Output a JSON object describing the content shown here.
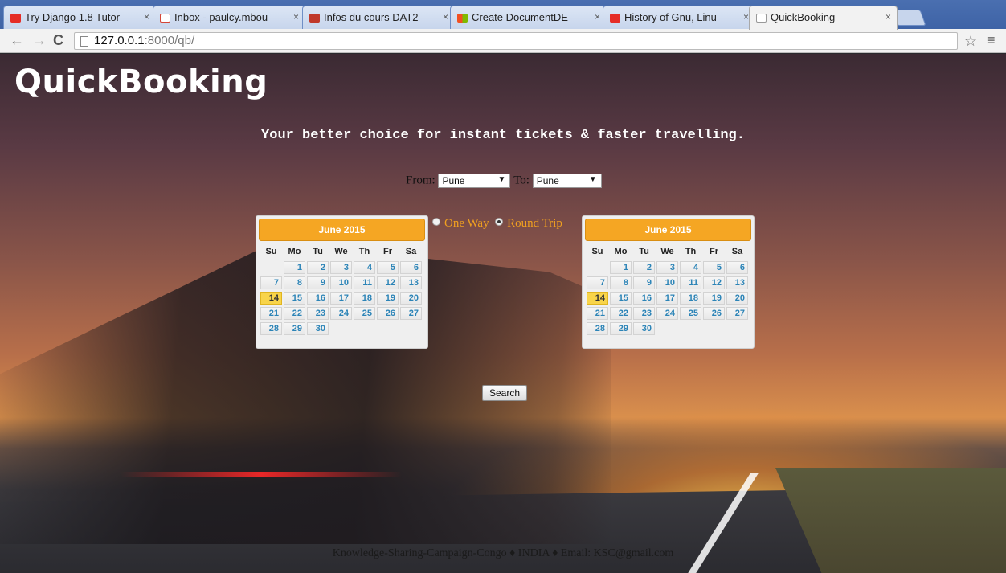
{
  "browser": {
    "tabs": [
      {
        "title": "Try Django 1.8 Tutor",
        "icon": "youtube-icon",
        "color": "#e52d27"
      },
      {
        "title": "Inbox - paulcy.mbou",
        "icon": "gmail-icon",
        "color": "#d44638"
      },
      {
        "title": "Infos du cours DAT2",
        "icon": "course-icon",
        "color": "#c0392b"
      },
      {
        "title": "Create DocumentDE",
        "icon": "windows-icon",
        "color": "#3a8fdd"
      },
      {
        "title": "History of Gnu, Linu",
        "icon": "youtube-icon",
        "color": "#e52d27"
      },
      {
        "title": "QuickBooking",
        "icon": "page-icon",
        "color": "#ffffff"
      }
    ],
    "url_host": "127.0.0.1",
    "url_path": ":8000/qb/"
  },
  "page": {
    "logo": "QuickBooking",
    "tagline": "Your better choice for instant tickets & faster travelling.",
    "from_label": "From:",
    "from_value": "Pune",
    "to_label": "To:",
    "to_value": "Pune",
    "trip_options": [
      "One Way",
      "Round Trip"
    ],
    "trip_selected": "Round Trip",
    "search_label": "Search",
    "footer": "Knowledge-Sharing-Campaign-Congo ♦ INDIA ♦ Email: KSC@gmail.com"
  },
  "calendars": [
    {
      "title": "June 2015",
      "today": 14
    },
    {
      "title": "June 2015",
      "today": 14
    }
  ],
  "weekdays": [
    "Su",
    "Mo",
    "Tu",
    "We",
    "Th",
    "Fr",
    "Sa"
  ],
  "days": [
    1,
    2,
    3,
    4,
    5,
    6,
    7,
    8,
    9,
    10,
    11,
    12,
    13,
    14,
    15,
    16,
    17,
    18,
    19,
    20,
    21,
    22,
    23,
    24,
    25,
    26,
    27,
    28,
    29,
    30
  ],
  "colors": {
    "accent": "#f5a623",
    "link": "#2c84b7",
    "today": "#f8d44a"
  }
}
